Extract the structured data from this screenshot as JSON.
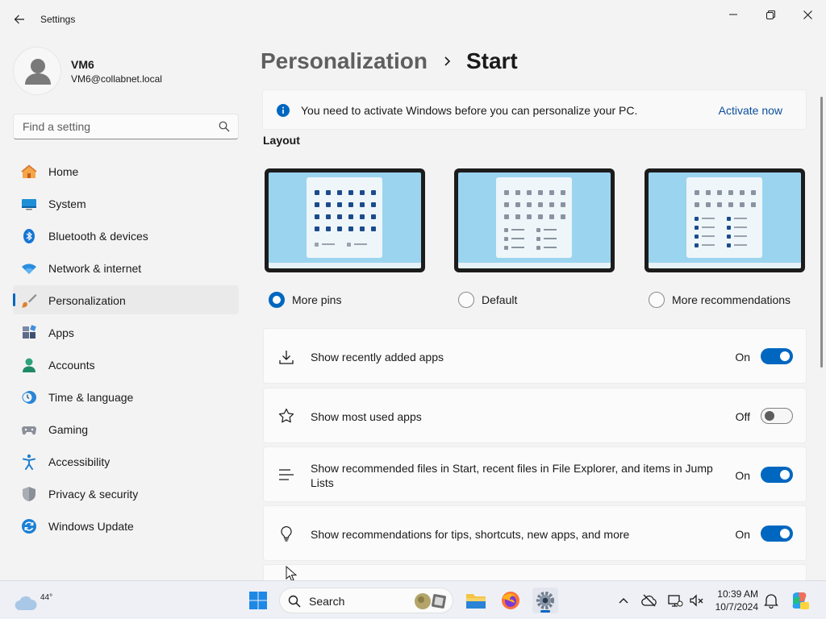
{
  "window": {
    "title": "Settings"
  },
  "profile": {
    "name": "VM6",
    "email": "VM6@collabnet.local"
  },
  "search": {
    "placeholder": "Find a setting"
  },
  "sidebar": {
    "items": [
      {
        "label": "Home",
        "icon": "home-icon"
      },
      {
        "label": "System",
        "icon": "system-icon"
      },
      {
        "label": "Bluetooth & devices",
        "icon": "bluetooth-icon"
      },
      {
        "label": "Network & internet",
        "icon": "wifi-icon"
      },
      {
        "label": "Personalization",
        "icon": "brush-icon",
        "selected": true
      },
      {
        "label": "Apps",
        "icon": "apps-icon"
      },
      {
        "label": "Accounts",
        "icon": "accounts-icon"
      },
      {
        "label": "Time & language",
        "icon": "clock-globe-icon"
      },
      {
        "label": "Gaming",
        "icon": "gamepad-icon"
      },
      {
        "label": "Accessibility",
        "icon": "accessibility-icon"
      },
      {
        "label": "Privacy & security",
        "icon": "shield-icon"
      },
      {
        "label": "Windows Update",
        "icon": "update-icon"
      }
    ]
  },
  "breadcrumb": {
    "parent": "Personalization",
    "current": "Start"
  },
  "activation": {
    "message": "You need to activate Windows before you can personalize your PC.",
    "link": "Activate now"
  },
  "layout": {
    "heading": "Layout",
    "options": [
      {
        "label": "More pins",
        "selected": true
      },
      {
        "label": "Default",
        "selected": false
      },
      {
        "label": "More recommendations",
        "selected": false
      }
    ]
  },
  "settings": [
    {
      "label": "Show recently added apps",
      "state": "On",
      "on": true,
      "icon": "download-icon"
    },
    {
      "label": "Show most used apps",
      "state": "Off",
      "on": false,
      "icon": "star-icon"
    },
    {
      "label": "Show recommended files in Start, recent files in File Explorer, and items in Jump Lists",
      "state": "On",
      "on": true,
      "icon": "list-icon"
    },
    {
      "label": "Show recommendations for tips, shortcuts, new apps, and more",
      "state": "On",
      "on": true,
      "icon": "lightbulb-icon"
    }
  ],
  "taskbar": {
    "weather_temp": "44°",
    "search_label": "Search",
    "time": "10:39 AM",
    "date": "10/7/2024"
  },
  "colors": {
    "accent": "#0067c0",
    "background": "#f3f3f3",
    "card": "#fbfbfb"
  }
}
